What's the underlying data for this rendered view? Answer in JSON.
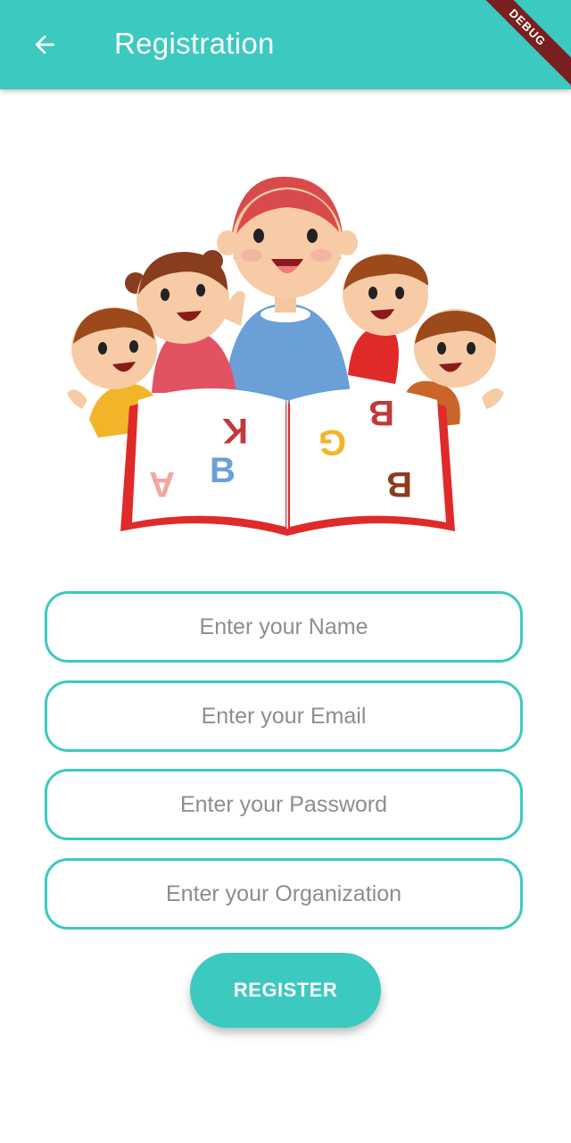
{
  "appbar": {
    "title": "Registration",
    "back_icon": "arrow-left-icon",
    "background": "#3cc9bf",
    "debug_banner": "DEBUG"
  },
  "illustration": {
    "name": "teacher-and-children-reading-book",
    "letters": [
      "K",
      "B",
      "A",
      "B",
      "G",
      "B"
    ]
  },
  "form": {
    "name_placeholder": "Enter your Name",
    "email_placeholder": "Enter your Email",
    "password_placeholder": "Enter your Password",
    "organization_placeholder": "Enter your Organization",
    "register_label": "REGISTER"
  },
  "colors": {
    "accent": "#3cc9bf",
    "placeholder": "#8d8d8d",
    "debug": "#7a1f1f"
  }
}
